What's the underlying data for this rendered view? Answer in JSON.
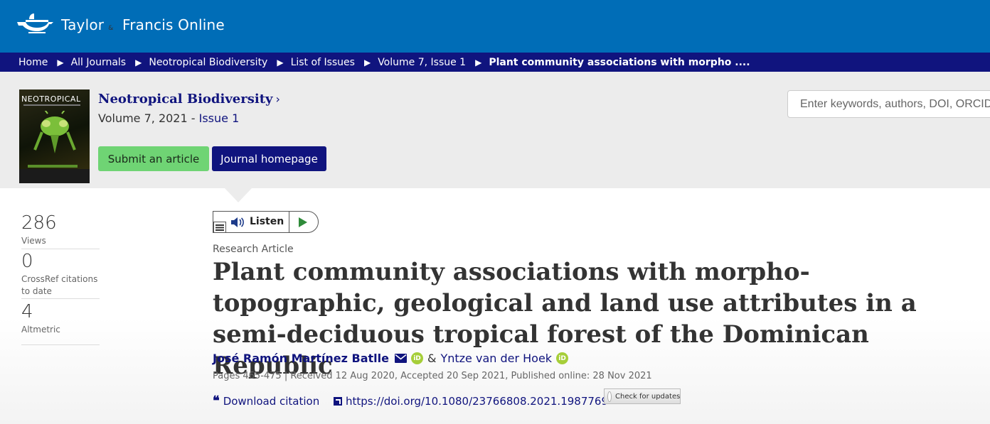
{
  "brand": {
    "name_part1": "Taylor",
    "name_amp": "&",
    "name_part2": "Francis Online"
  },
  "breadcrumb": [
    "Home",
    "All Journals",
    "Neotropical Biodiversity",
    "List of Issues",
    "Volume 7, Issue 1",
    "Plant community associations with morpho ...."
  ],
  "journal": {
    "cover_title": "NEOTROPICAL",
    "name": "Neotropical Biodiversity",
    "volume": "Volume 7, 2021",
    "issue": "Issue 1",
    "submit_label": "Submit an article",
    "homepage_label": "Journal homepage"
  },
  "search": {
    "placeholder": "Enter keywords, authors, DOI, ORCID"
  },
  "metrics": [
    {
      "value": "286",
      "label": "Views"
    },
    {
      "value": "0",
      "label": "CrossRef citations to date"
    },
    {
      "value": "4",
      "label": "Altmetric"
    }
  ],
  "listen": {
    "label": "Listen"
  },
  "article": {
    "type": "Research Article",
    "title": "Plant community associations with morpho-topographic, geological and land use attributes in a semi-deciduous tropical forest of the Dominican Republic",
    "authors": [
      {
        "name": "José Ramón Martínez Batlle"
      },
      {
        "name": "Yntze van der Hoek"
      }
    ],
    "author_joiner": "&",
    "pub_info": "Pages 465-475 | Received 12 Aug 2020, Accepted 20 Sep 2021, Published online: 28 Nov 2021",
    "download_citation": "Download citation",
    "doi": "https://doi.org/10.1080/23766808.2021.1987769",
    "check_updates": "Check for updates"
  },
  "colors": {
    "header": "#006db7",
    "navy": "#10147e",
    "submit_green": "#6fd474",
    "orcid": "#a6ce39"
  }
}
